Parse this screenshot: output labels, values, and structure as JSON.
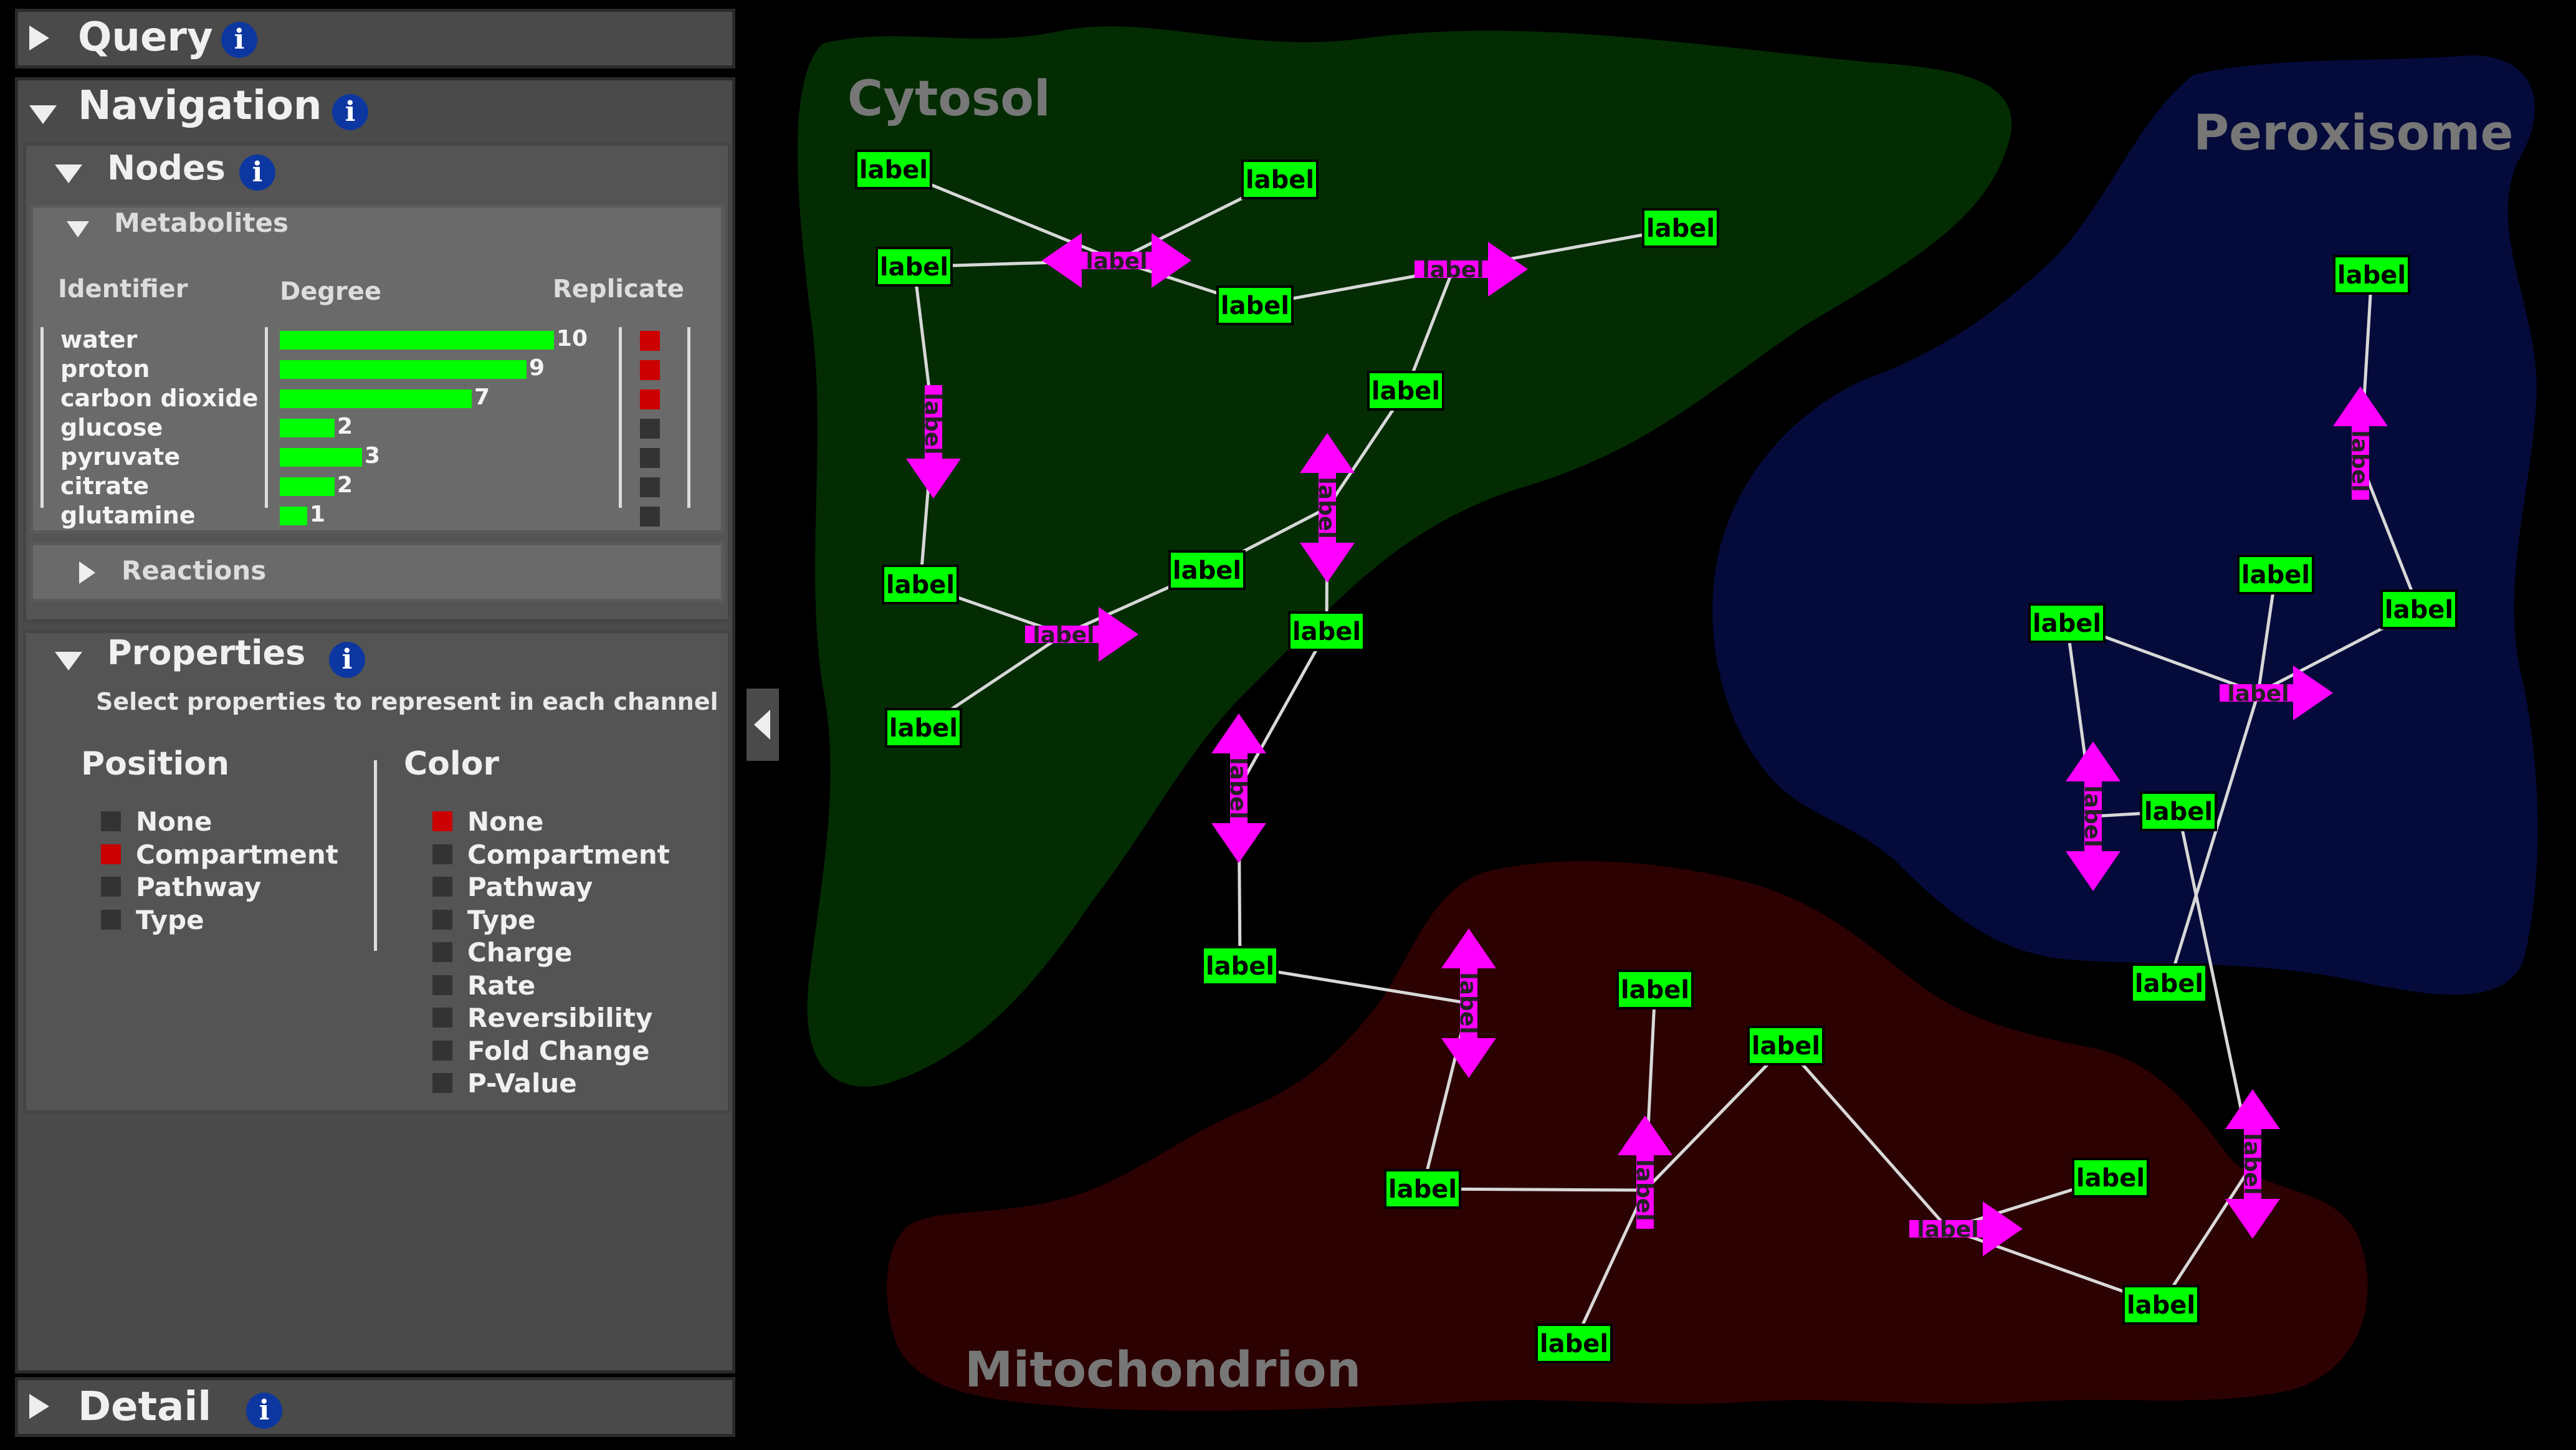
{
  "panels": {
    "query": {
      "title": "Query"
    },
    "navigation": {
      "title": "Navigation"
    },
    "nodes": {
      "title": "Nodes"
    },
    "metabolites": {
      "title": "Metabolites"
    },
    "reactions": {
      "title": "Reactions"
    },
    "properties": {
      "title": "Properties",
      "subtitle": "Select properties to represent in each channel"
    },
    "detail": {
      "title": "Detail"
    }
  },
  "metabolites_table": {
    "columns": {
      "identifier": "Identifier",
      "degree": "Degree",
      "replicate": "Replicate"
    },
    "rows": [
      {
        "name": "water",
        "degree": 10,
        "replicate": true
      },
      {
        "name": "proton",
        "degree": 9,
        "replicate": true
      },
      {
        "name": "carbon dioxide",
        "degree": 7,
        "replicate": true
      },
      {
        "name": "glucose",
        "degree": 2,
        "replicate": false
      },
      {
        "name": "pyruvate",
        "degree": 3,
        "replicate": false
      },
      {
        "name": "citrate",
        "degree": 2,
        "replicate": false
      },
      {
        "name": "glutamine",
        "degree": 1,
        "replicate": false
      }
    ]
  },
  "channels": {
    "position": {
      "title": "Position",
      "options": [
        "None",
        "Compartment",
        "Pathway",
        "Type"
      ],
      "selected": "Compartment"
    },
    "color": {
      "title": "Color",
      "options": [
        "None",
        "Compartment",
        "Pathway",
        "Type",
        "Charge",
        "Rate",
        "Reversibility",
        "Fold Change",
        "P-Value"
      ],
      "selected": "None"
    }
  },
  "graph": {
    "compartments": [
      {
        "name": "Cytosol",
        "color": "#032c03"
      },
      {
        "name": "Peroxisome",
        "color": "#040b3a"
      },
      {
        "name": "Mitochondrion",
        "color": "#2c0101"
      }
    ],
    "node_label": "label",
    "reaction_label": "label",
    "colors": {
      "node": "#00ff00",
      "reaction": "#ff00ff",
      "edge": "#d8d8d8",
      "selected": "#cc0000",
      "info": "#0d37a0"
    }
  }
}
